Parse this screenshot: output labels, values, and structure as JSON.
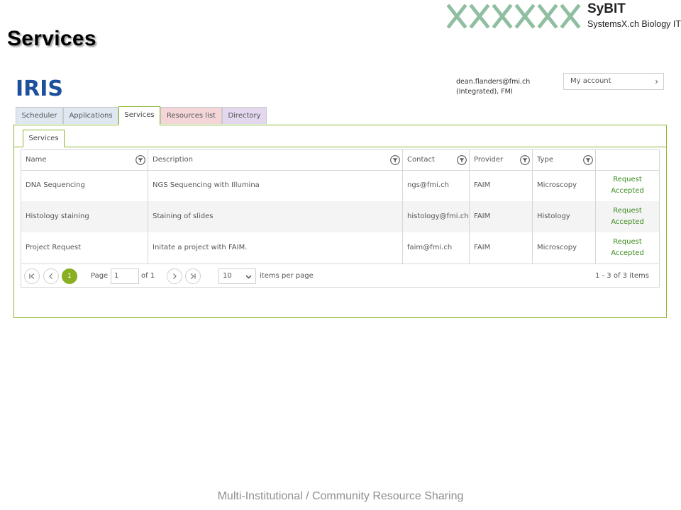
{
  "slide": {
    "title": "Services",
    "footer": "Multi-Institutional / Community Resource Sharing",
    "logo": {
      "name": "SyBIT",
      "subtitle": "SystemsX.ch Biology IT"
    }
  },
  "app": {
    "logo_text": "IRIS",
    "user": {
      "email": "dean.flanders@fmi.ch",
      "org": "(Integrated), FMI"
    },
    "account_label": "My account"
  },
  "tabs": [
    {
      "label": "Scheduler",
      "color": "#dfe8f1"
    },
    {
      "label": "Applications",
      "color": "#dfe8f1"
    },
    {
      "label": "Services",
      "color": "#ffffff",
      "active": true
    },
    {
      "label": "Resources list",
      "color": "#f4d6d8"
    },
    {
      "label": "Directory",
      "color": "#e3d8ee"
    }
  ],
  "subtab": {
    "label": "Services"
  },
  "grid": {
    "columns": [
      "Name",
      "Description",
      "Contact",
      "Provider",
      "Type"
    ],
    "rows": [
      {
        "name": "DNA Sequencing",
        "description": "NGS Sequencing with Illumina",
        "contact": "ngs@fmi.ch",
        "provider": "FAIM",
        "type": "Microscopy",
        "status_line1": "Request",
        "status_line2": "Accepted"
      },
      {
        "name": "Histology staining",
        "description": "Staining of slides",
        "contact": "histology@fmi.ch",
        "provider": "FAIM",
        "type": "Histology",
        "status_line1": "Request",
        "status_line2": "Accepted"
      },
      {
        "name": "Project Request",
        "description": "Initate a project with FAIM.",
        "contact": "faim@fmi.ch",
        "provider": "FAIM",
        "type": "Microscopy",
        "status_line1": "Request",
        "status_line2": "Accepted"
      }
    ]
  },
  "pager": {
    "current_page": "1",
    "page_label": "Page",
    "page_value": "1",
    "of_label": "of 1",
    "per_page_value": "10",
    "per_page_label": "items per page",
    "summary": "1 - 3 of 3 items"
  },
  "colors": {
    "accent_green": "#8bb832",
    "status_green": "#3a8a1e",
    "iris_blue": "#1c4f9c"
  }
}
